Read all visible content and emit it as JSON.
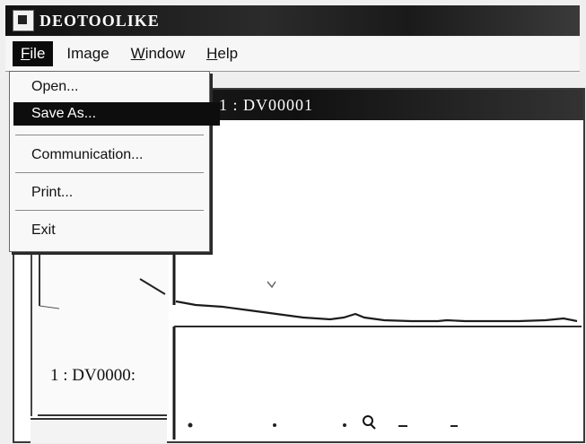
{
  "app": {
    "title": "DEOTOOLIKE"
  },
  "menubar": {
    "items": [
      {
        "label": "File",
        "mnemonic": "F",
        "rest": "ile"
      },
      {
        "label": "Image",
        "mnemonic": "",
        "rest": "Image"
      },
      {
        "label": "Window",
        "mnemonic": "W",
        "rest": "indow"
      },
      {
        "label": "Help",
        "mnemonic": "H",
        "rest": "elp"
      }
    ]
  },
  "file_menu": {
    "items": [
      {
        "label": "Open..."
      },
      {
        "label": "Save As..."
      },
      {
        "label": "Communication..."
      },
      {
        "label": "Print..."
      },
      {
        "label": "Exit"
      }
    ]
  },
  "document": {
    "title": "1 : DV00001",
    "left_label": "1 : DV0000:"
  },
  "colors": {
    "titlebar": "#111111",
    "highlight": "#0d0d0d",
    "window_bg": "#ffffff"
  }
}
